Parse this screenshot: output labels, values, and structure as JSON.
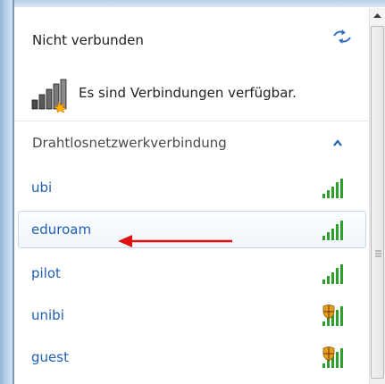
{
  "header": {
    "title": "Nicht verbunden",
    "refresh_icon": "network-refresh-icon"
  },
  "status": {
    "text": "Es sind Verbindungen verfügbar.",
    "icon": "network-bars-starburst-icon"
  },
  "section": {
    "title": "Drahtlosnetzwerkverbindung",
    "collapse_icon": "chevron-up-icon"
  },
  "networks": [
    {
      "name": "ubi",
      "secured": false,
      "selected": false
    },
    {
      "name": "eduroam",
      "secured": false,
      "selected": true
    },
    {
      "name": "pilot",
      "secured": false,
      "selected": false
    },
    {
      "name": "unibi",
      "secured": true,
      "selected": false
    },
    {
      "name": "guest",
      "secured": true,
      "selected": false
    }
  ],
  "annotation": {
    "icon": "red-arrow-icon",
    "color": "#e01010"
  },
  "colors": {
    "link": "#1f5fb0",
    "signal_green": "#2e9e2e",
    "shield": "#e0a020"
  }
}
